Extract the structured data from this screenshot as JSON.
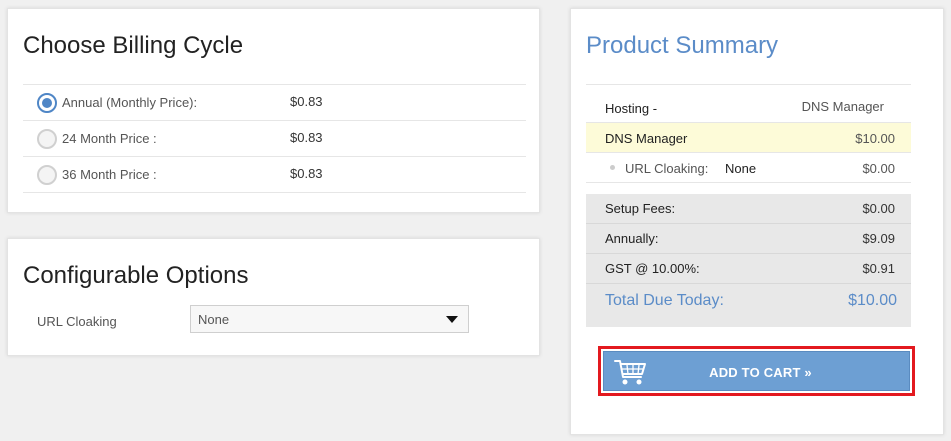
{
  "billing": {
    "title": "Choose Billing Cycle",
    "options": [
      {
        "label": "Annual (Monthly Price):",
        "price": "$0.83",
        "selected": true
      },
      {
        "label": "24 Month Price :",
        "price": "$0.83",
        "selected": false
      },
      {
        "label": "36 Month Price :",
        "price": "$0.83",
        "selected": false
      }
    ]
  },
  "configurable": {
    "title": "Configurable Options",
    "url_cloaking_label": "URL Cloaking",
    "url_cloaking_value": "None"
  },
  "summary": {
    "title": "Product Summary",
    "hosting_label": "Hosting -",
    "hosting_value": "DNS Manager",
    "product_name": "DNS Manager",
    "product_price": "$10.00",
    "addon_label": "URL Cloaking:",
    "addon_value": "None",
    "addon_price": "$0.00",
    "setup_label": "Setup Fees:",
    "setup_value": "$0.00",
    "annually_label": "Annually:",
    "annually_value": "$9.09",
    "gst_label": "GST @ 10.00%:",
    "gst_value": "$0.91",
    "total_label": "Total Due Today:",
    "total_value": "$10.00",
    "add_to_cart_label": "ADD TO CART »",
    "accent_color": "#5b8cc8",
    "highlight_color": "#e3191f"
  },
  "icons": {
    "cart": "shopping-cart-icon",
    "dropdown": "chevron-down-icon"
  }
}
